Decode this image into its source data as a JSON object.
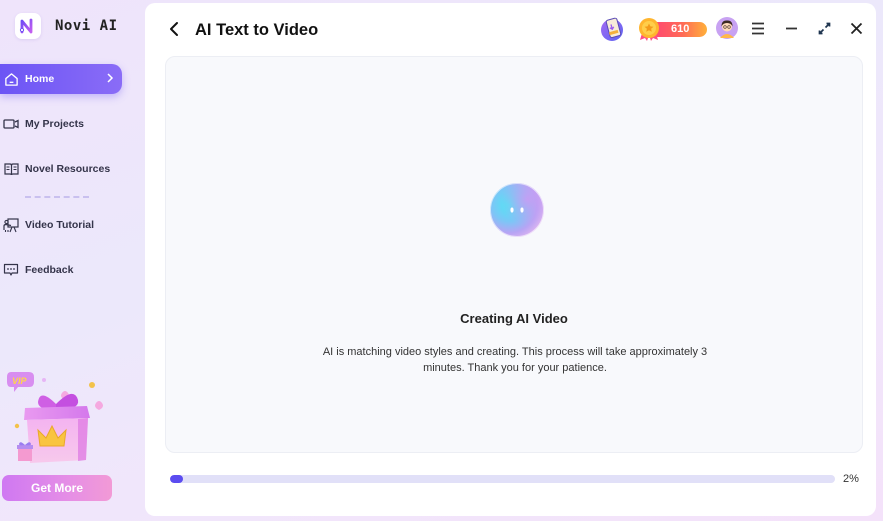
{
  "app": {
    "name": "Novi AI",
    "logo_icon": "novi-logo-icon"
  },
  "sidebar": {
    "items": [
      {
        "label": "Home",
        "icon": "home-icon",
        "active": true
      },
      {
        "label": "My Projects",
        "icon": "video-camera-icon",
        "active": false
      },
      {
        "label": "Novel Resources",
        "icon": "book-icon",
        "active": false
      },
      {
        "label": "Video Tutorial",
        "icon": "presentation-icon",
        "active": false
      },
      {
        "label": "Feedback",
        "icon": "chat-bubble-icon",
        "active": false
      }
    ],
    "promo": {
      "badge": "VIP",
      "button_label": "Get More"
    }
  },
  "header": {
    "title": "AI Text to Video",
    "points": "610",
    "icons": [
      "back-icon",
      "download-app-icon",
      "medal-icon",
      "avatar",
      "menu-icon",
      "minimize-icon",
      "maximize-icon",
      "close-icon"
    ]
  },
  "status": {
    "title": "Creating AI Video",
    "description": "AI is matching video styles and creating. This process will take approximately 3 minutes. Thank you for your patience."
  },
  "progress": {
    "value": 2,
    "label": "2%"
  },
  "colors": {
    "accent": "#6c55f5",
    "progress_fill": "#5b4cf0",
    "progress_track": "#e1e0f8",
    "promo_button": "#e58ee6"
  }
}
